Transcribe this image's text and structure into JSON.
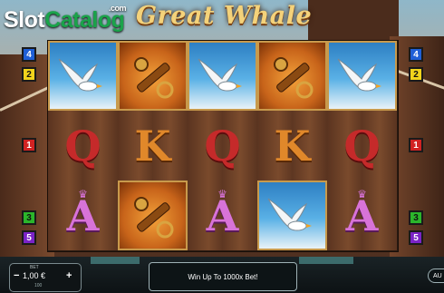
{
  "logo": {
    "slot": "Slot",
    "catalog": "Catalog",
    "com": ".com"
  },
  "title": "Great Whale",
  "paylines": {
    "left": [
      "4",
      "2",
      "1",
      "3",
      "5"
    ],
    "right": [
      "4",
      "2",
      "1",
      "3",
      "5"
    ],
    "colors": {
      "blue": "#1f5fd6",
      "yellow": "#f1d31c",
      "red": "#d12222",
      "green": "#2bb52b",
      "purple": "#7b23c7"
    }
  },
  "reels": [
    [
      "seagull-icon",
      "Q",
      "A"
    ],
    [
      "spyglass-icon",
      "K",
      "spyglass-icon"
    ],
    [
      "seagull-icon",
      "Q",
      "A"
    ],
    [
      "spyglass-icon",
      "K",
      "seagull-icon"
    ],
    [
      "seagull-icon",
      "Q",
      "A"
    ]
  ],
  "bet": {
    "label": "BET",
    "value": "1,00 €",
    "minus": "−",
    "plus": "+",
    "sub": "100"
  },
  "win_message": "Win Up To 1000x Bet!",
  "auto_label": "AU"
}
